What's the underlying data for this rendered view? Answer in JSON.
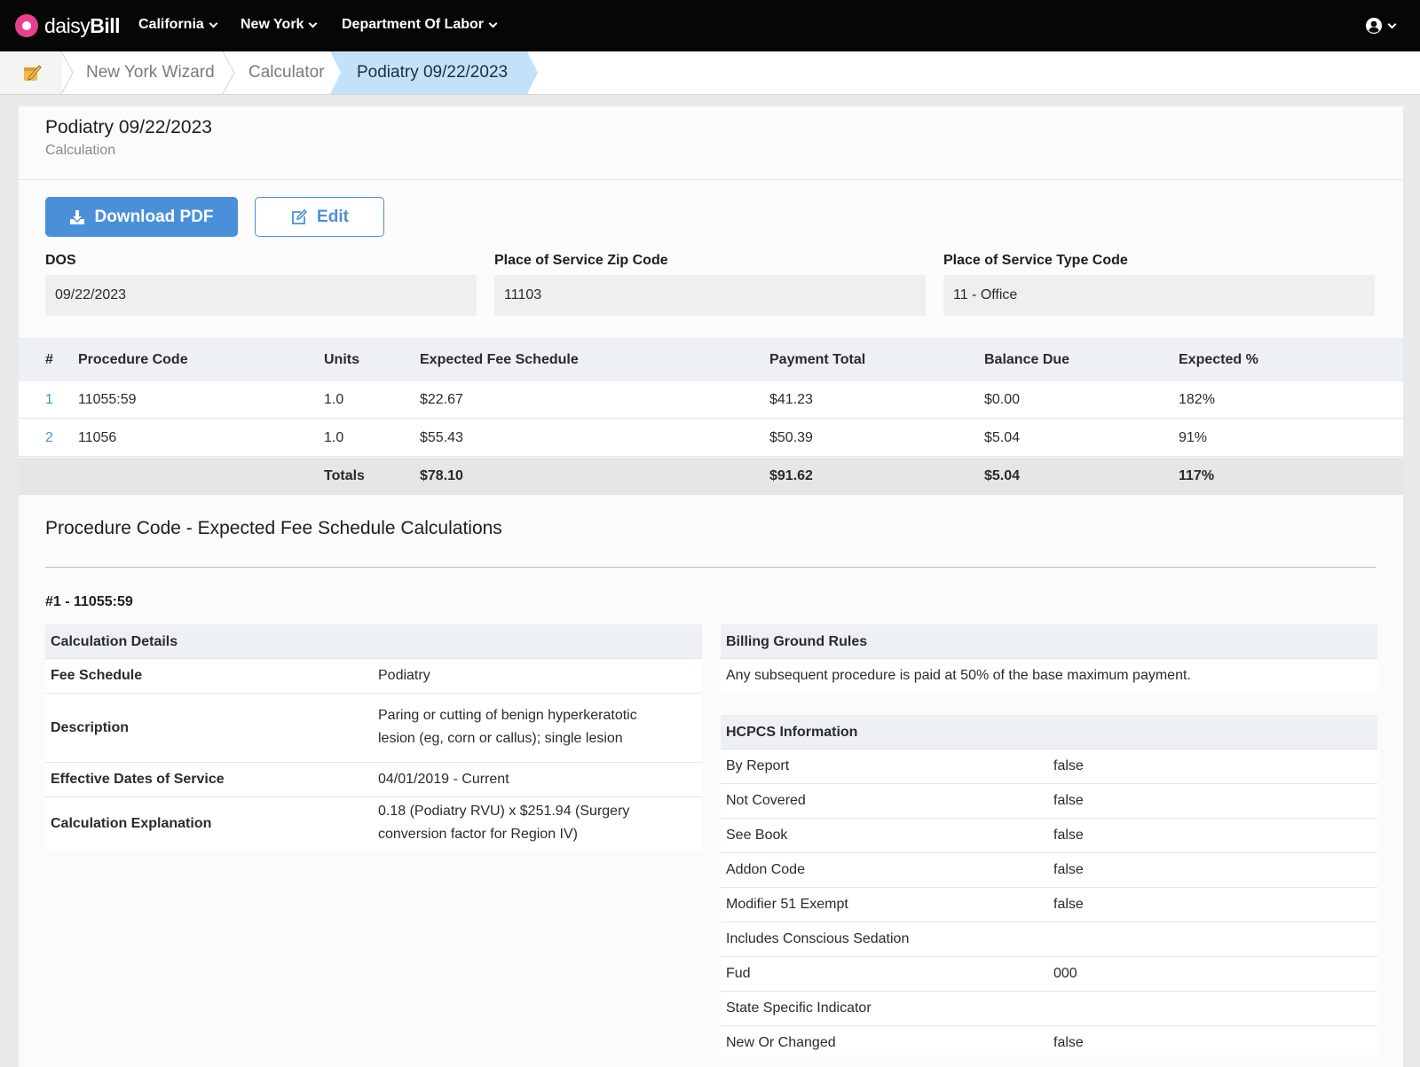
{
  "app": {
    "logo_text_light": "daisy",
    "logo_text_bold": "Bill",
    "brand_color": "#e8408f",
    "accent_color": "#4a90d9"
  },
  "nav": {
    "items": [
      {
        "label": "California"
      },
      {
        "label": "New York"
      },
      {
        "label": "Department Of Labor"
      }
    ],
    "user_icon": "user-circle-icon"
  },
  "breadcrumb": {
    "home_icon": "notepad-icon",
    "items": [
      {
        "label": "New York Wizard"
      },
      {
        "label": "Calculator"
      },
      {
        "label": "Podiatry 09/22/2023"
      }
    ]
  },
  "page": {
    "title": "Podiatry 09/22/2023",
    "subtitle": "Calculation",
    "download_label": "Download PDF",
    "edit_label": "Edit"
  },
  "fields": {
    "dos": {
      "label": "DOS",
      "value": "09/22/2023"
    },
    "zip": {
      "label": "Place of Service Zip Code",
      "value": "11103"
    },
    "type": {
      "label": "Place of Service Type Code",
      "value": "11 - Office"
    }
  },
  "procedures": {
    "headers": [
      "#",
      "Procedure Code",
      "Units",
      "Expected Fee Schedule",
      "Payment Total",
      "Balance Due",
      "Expected %"
    ],
    "rows": [
      {
        "num": "1",
        "code": "11055:59",
        "units": "1.0",
        "expected": "$22.67",
        "payment": "$41.23",
        "balance": "$0.00",
        "pct": "182%"
      },
      {
        "num": "2",
        "code": "11056",
        "units": "1.0",
        "expected": "$55.43",
        "payment": "$50.39",
        "balance": "$5.04",
        "pct": "91%"
      }
    ],
    "totals": {
      "label": "Totals",
      "expected": "$78.10",
      "payment": "$91.62",
      "balance": "$5.04",
      "pct": "117%"
    }
  },
  "calculations": {
    "section_title": "Procedure Code - Expected Fee Schedule Calculations",
    "item_title": "#1 - 11055:59",
    "details": {
      "header": "Calculation Details",
      "rows": [
        {
          "key": "Fee Schedule",
          "value": "Podiatry"
        },
        {
          "key": "Description",
          "value": "Paring or cutting of benign hyperkeratotic lesion (eg, corn or callus); single lesion"
        },
        {
          "key": "Effective Dates of Service",
          "value": "04/01/2019 - Current"
        },
        {
          "key": "Calculation Explanation",
          "value": "0.18 (Podiatry RVU) x $251.94 (Surgery conversion factor for Region IV)"
        }
      ]
    },
    "ground_rules": {
      "header": "Billing Ground Rules",
      "text": "Any subsequent procedure is paid at 50% of the base maximum payment."
    },
    "hcpcs": {
      "header": "HCPCS Information",
      "rows": [
        {
          "key": "By Report",
          "value": "false"
        },
        {
          "key": "Not Covered",
          "value": "false"
        },
        {
          "key": "See Book",
          "value": "false"
        },
        {
          "key": "Addon Code",
          "value": "false"
        },
        {
          "key": "Modifier 51 Exempt",
          "value": "false"
        },
        {
          "key": "Includes Conscious Sedation",
          "value": ""
        },
        {
          "key": "Fud",
          "value": "000"
        },
        {
          "key": "State Specific Indicator",
          "value": ""
        },
        {
          "key": "New Or Changed",
          "value": "false"
        }
      ]
    }
  }
}
